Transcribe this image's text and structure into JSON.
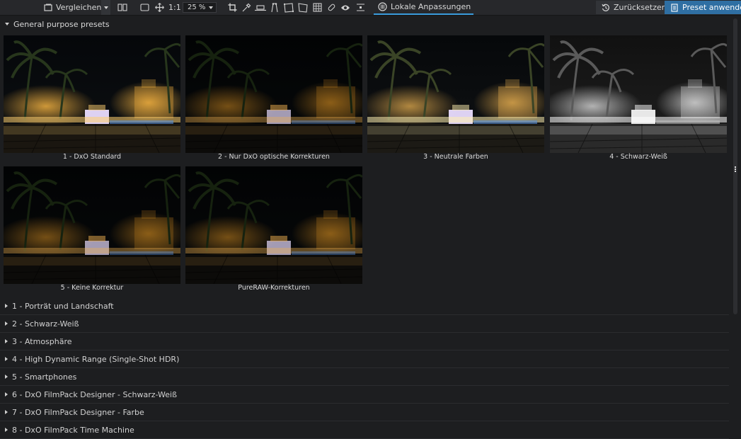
{
  "toolbar": {
    "compare_label": "Vergleichen",
    "ratio_label": "1:1",
    "zoom_value": "25 %",
    "local_adjustments_label": "Lokale Anpassungen",
    "reset_label": "Zurücksetzen",
    "apply_label": "Preset anwenden"
  },
  "section": {
    "title": "General purpose presets",
    "presets": [
      {
        "label": "1 - DxO Standard",
        "style": "standard"
      },
      {
        "label": "2 - Nur DxO optische Korrekturen",
        "style": "dark"
      },
      {
        "label": "3 - Neutrale Farben",
        "style": "neutral"
      },
      {
        "label": "4 - Schwarz-Weiß",
        "style": "bw"
      },
      {
        "label": "5 - Keine Korrektur",
        "style": "dark"
      },
      {
        "label": "PureRAW-Korrekturen",
        "style": "dark"
      }
    ]
  },
  "categories": [
    {
      "label": "1 - Porträt und Landschaft"
    },
    {
      "label": "2 - Schwarz-Weiß"
    },
    {
      "label": "3 - Atmosphäre"
    },
    {
      "label": "4 - High Dynamic Range (Single-Shot HDR)"
    },
    {
      "label": "5 - Smartphones"
    },
    {
      "label": "6 - DxO FilmPack Designer - Schwarz-Weiß"
    },
    {
      "label": "7 - DxO FilmPack Designer - Farbe"
    },
    {
      "label": "8 - DxO FilmPack Time Machine"
    }
  ],
  "colors": {
    "accent": "#3a9bdc",
    "apply_button": "#2f6fa3",
    "background": "#1d1e20",
    "toolbar": "#27282b"
  }
}
